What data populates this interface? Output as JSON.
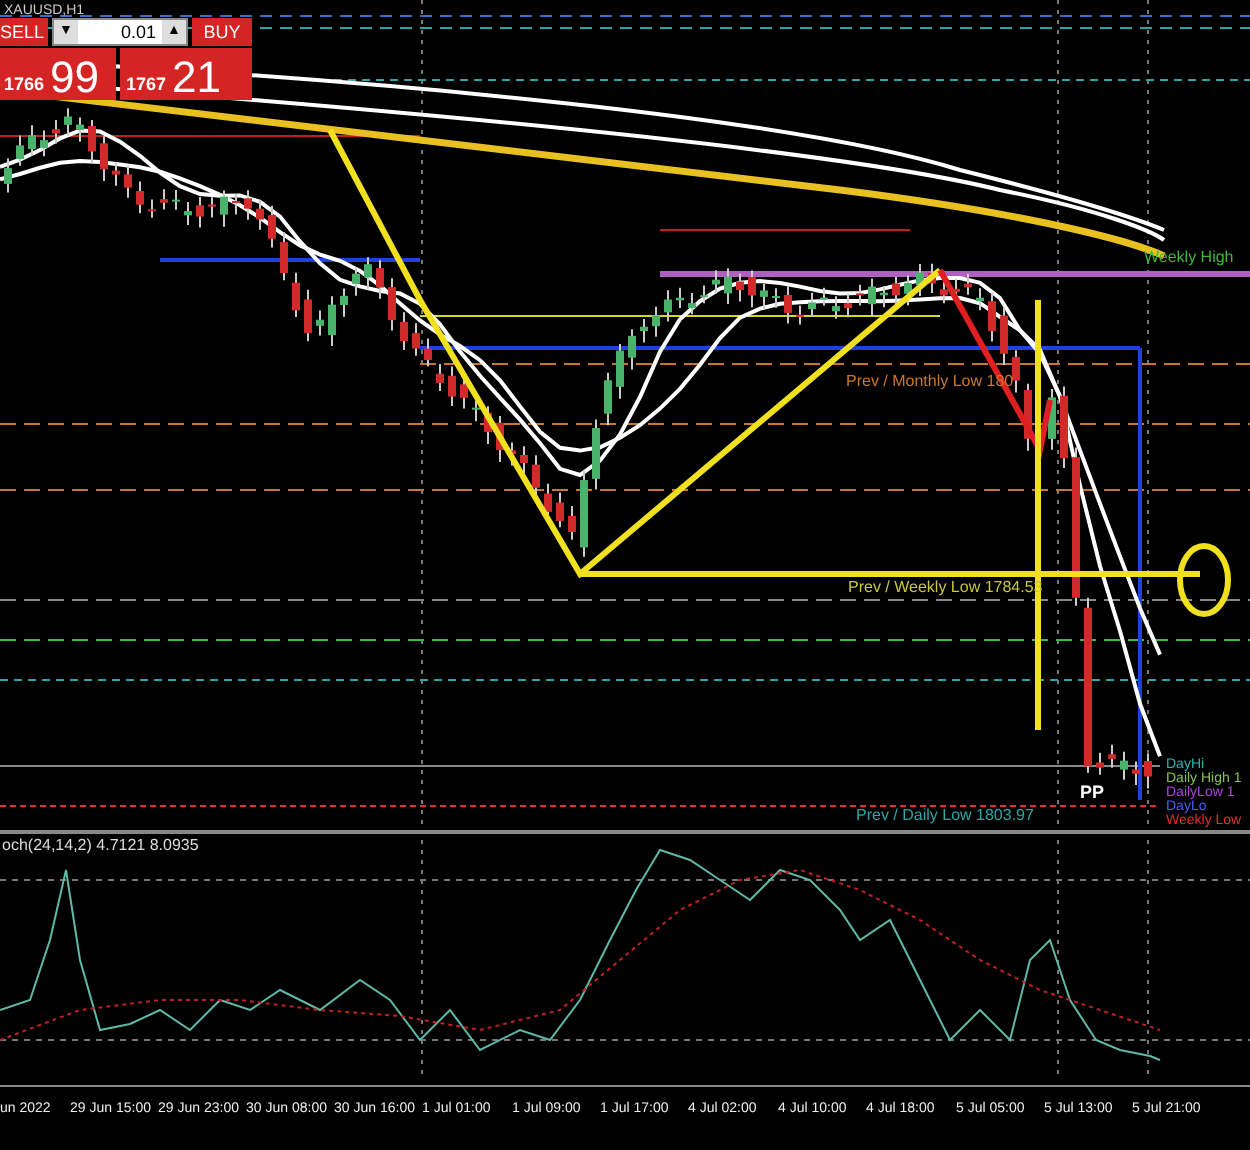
{
  "chart": {
    "symbol": "XAUUSD,H1"
  },
  "trade_panel": {
    "sell_label": "SELL",
    "buy_label": "BUY",
    "lot": "0.01",
    "sell_price_main": "1766",
    "sell_price_big": "99",
    "buy_price_main": "1767",
    "buy_price_big": "21",
    "down_arrow": "▼",
    "up_arrow": "▲"
  },
  "levels": [
    {
      "label": "Weekly High",
      "color": "#3cb83c"
    },
    {
      "label": "Prev / Monthly Low 180",
      "color": "#c8782a"
    },
    {
      "label": "Prev / Weekly Low 1784.53",
      "color": "#c8c83c"
    },
    {
      "label": "Prev / Daily Low 1803.97",
      "color": "#2aa6a6"
    },
    {
      "label": "DayHi",
      "color": "#2ab4b4"
    },
    {
      "label": "Daily High 1",
      "color": "#82c850"
    },
    {
      "label": "DailyLow 1",
      "color": "#b040e0"
    },
    {
      "label": "DayLo",
      "color": "#4a5cff"
    },
    {
      "label": "Weekly Low",
      "color": "#e03030"
    }
  ],
  "pivot_label": "PP",
  "indicator": {
    "label": "och(24,14,2) 4.7121 8.0935"
  },
  "time_axis": [
    "un 2022",
    "29 Jun 15:00",
    "29 Jun 23:00",
    "30 Jun 08:00",
    "30 Jun 16:00",
    "1 Jul 01:00",
    "1 Jul 09:00",
    "1 Jul 17:00",
    "4 Jul 02:00",
    "4 Jul 10:00",
    "4 Jul 18:00",
    "5 Jul 05:00",
    "5 Jul 13:00",
    "5 Jul 21:00"
  ]
}
